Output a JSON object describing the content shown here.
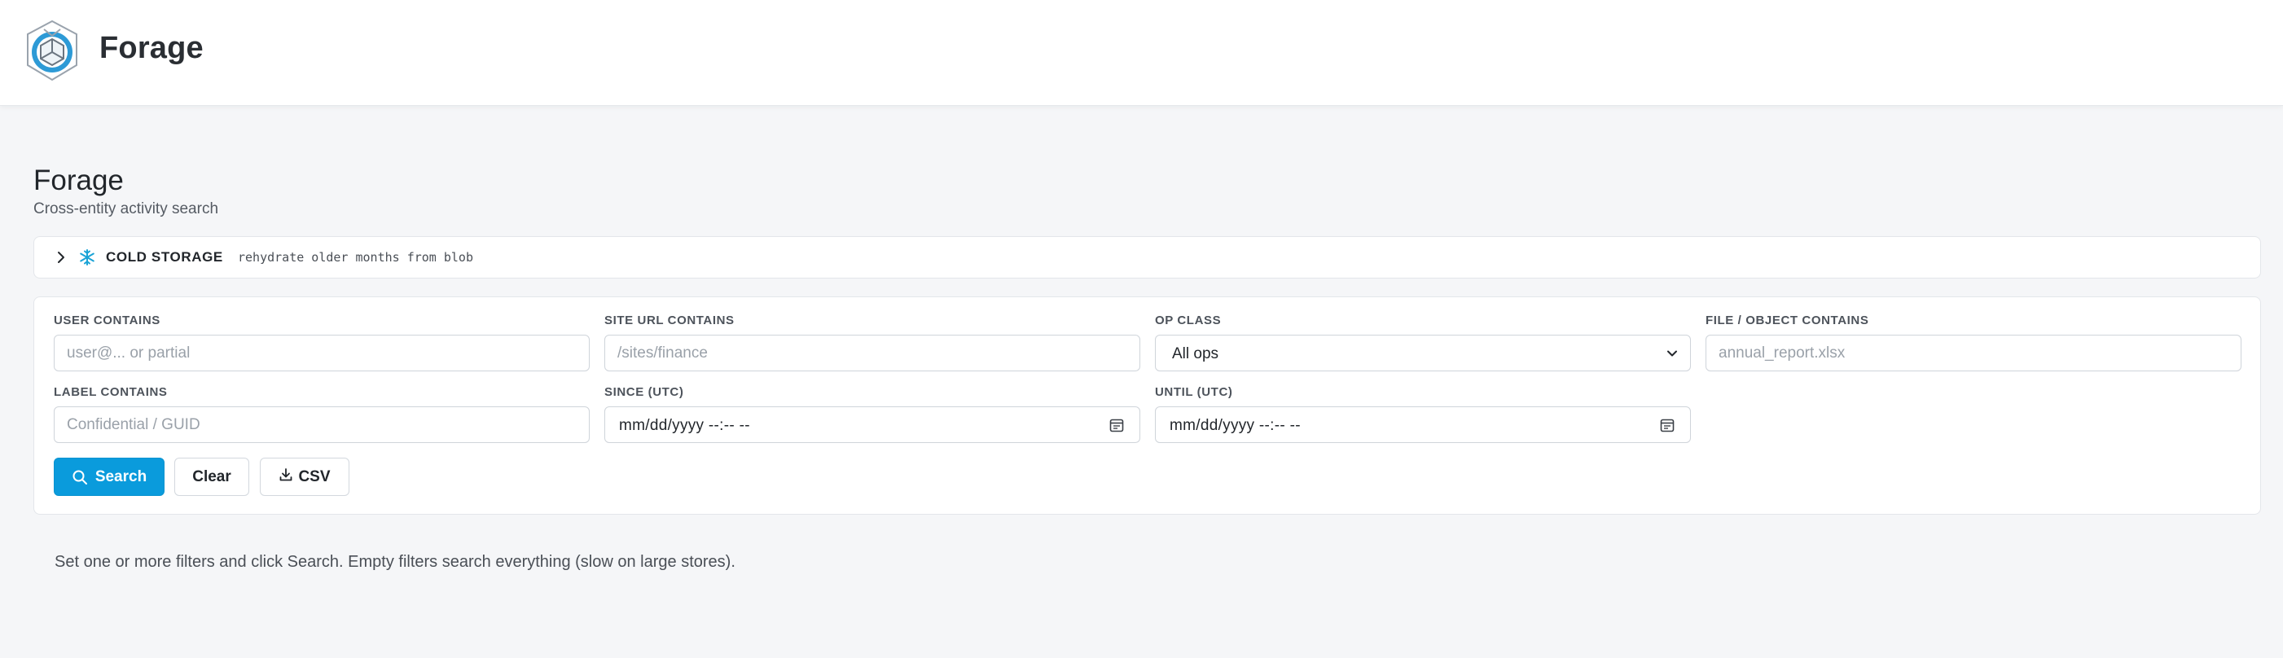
{
  "app": {
    "brand": "Forage"
  },
  "page": {
    "title": "Forage",
    "subtitle": "Cross-entity activity search"
  },
  "cold_storage": {
    "title": "COLD STORAGE",
    "hint": "rehydrate older months from blob",
    "accent": "#1aa3d6"
  },
  "filters": {
    "user": {
      "label": "USER CONTAINS",
      "placeholder": "user@... or partial",
      "value": ""
    },
    "site": {
      "label": "SITE URL CONTAINS",
      "placeholder": "/sites/finance",
      "value": ""
    },
    "op_class": {
      "label": "OP CLASS",
      "selected": "All ops"
    },
    "file": {
      "label": "FILE / OBJECT CONTAINS",
      "placeholder": "annual_report.xlsx",
      "value": ""
    },
    "label_field": {
      "label": "LABEL CONTAINS",
      "placeholder": "Confidential / GUID",
      "value": ""
    },
    "since": {
      "label": "SINCE (UTC)",
      "value": "mm/dd/yyyy --:-- --"
    },
    "until": {
      "label": "UNTIL (UTC)",
      "value": "mm/dd/yyyy --:-- --"
    }
  },
  "actions": {
    "search_label": "Search",
    "clear_label": "Clear",
    "csv_label": "CSV",
    "primary_color": "#0a9bdc"
  },
  "help_text": "Set one or more filters and click Search. Empty filters search everything (slow on large stores)."
}
